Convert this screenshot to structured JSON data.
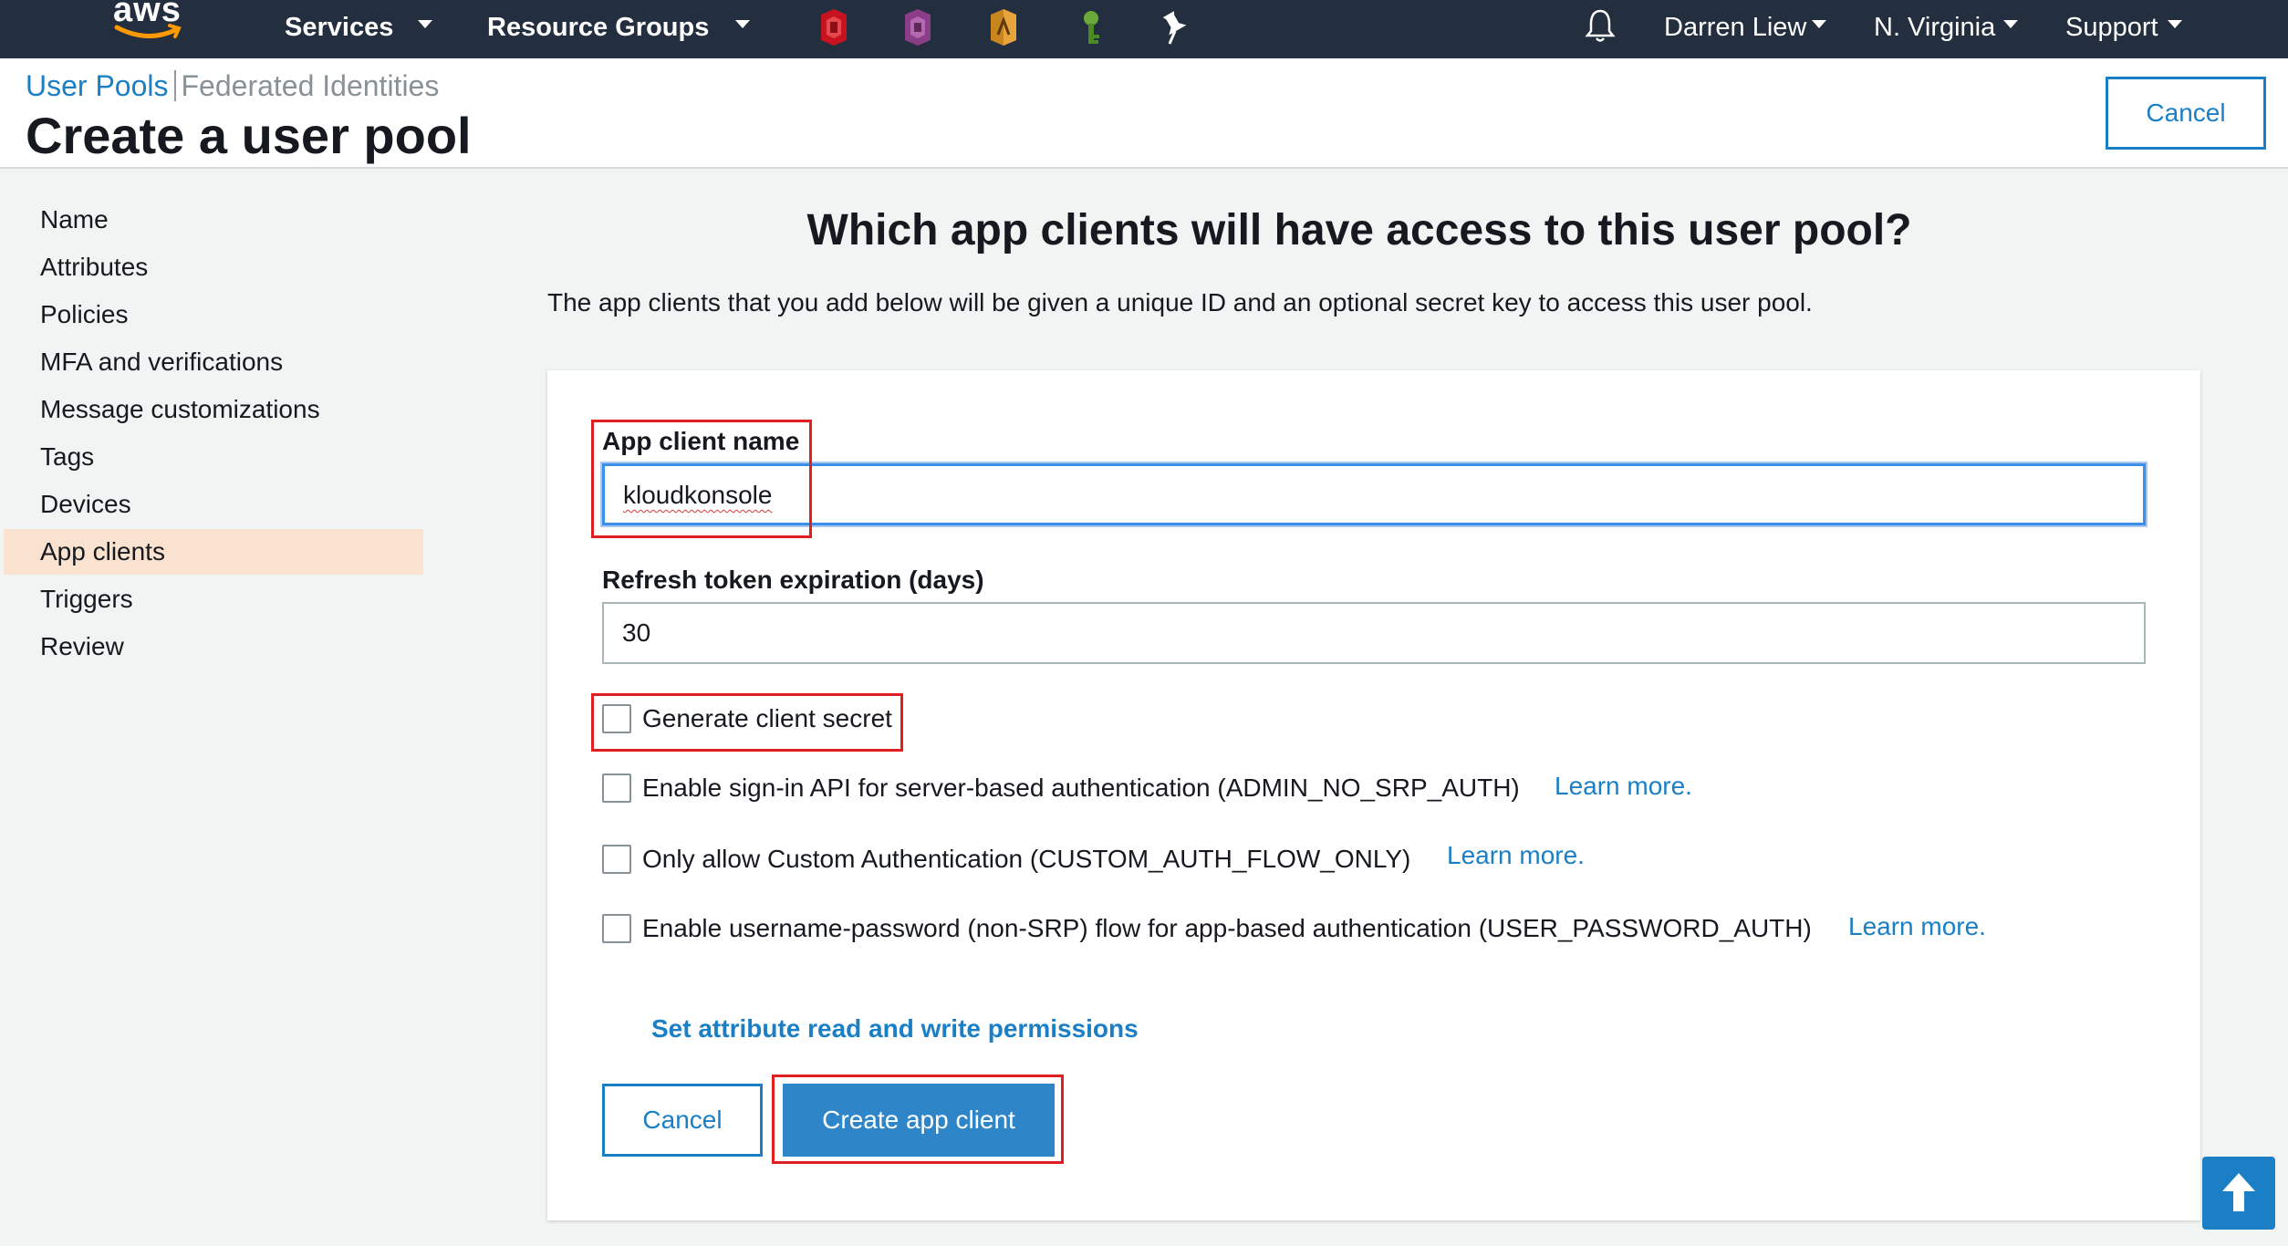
{
  "nav": {
    "logo": "aws",
    "services": "Services",
    "resource_groups": "Resource Groups",
    "pinned_icons": [
      "cloudtrail-icon",
      "cognito-icon",
      "lambda-icon",
      "iam-key-icon",
      "pin-icon"
    ],
    "user": "Darren Liew",
    "region": "N. Virginia",
    "support": "Support",
    "colors": {
      "bar": "#232f3e",
      "accent": "#ff9900"
    }
  },
  "header": {
    "crumb_user_pools": "User Pools",
    "crumb_federated": "Federated Identities",
    "title": "Create a user pool",
    "cancel": "Cancel"
  },
  "sidebar": {
    "items": [
      {
        "label": "Name"
      },
      {
        "label": "Attributes"
      },
      {
        "label": "Policies"
      },
      {
        "label": "MFA and verifications"
      },
      {
        "label": "Message customizations"
      },
      {
        "label": "Tags"
      },
      {
        "label": "Devices"
      },
      {
        "label": "App clients",
        "active": true
      },
      {
        "label": "Triggers"
      },
      {
        "label": "Review"
      }
    ]
  },
  "main": {
    "heading": "Which app clients will have access to this user pool?",
    "description": "The app clients that you add below will be given a unique ID and an optional secret key to access this user pool.",
    "form": {
      "client_name_label": "App client name",
      "client_name_value": "kloudkonsole",
      "refresh_label": "Refresh token expiration (days)",
      "refresh_value": "30",
      "options": [
        {
          "label": "Generate client secret",
          "checked": false
        },
        {
          "label": "Enable sign-in API for server-based authentication (ADMIN_NO_SRP_AUTH)",
          "checked": false,
          "link": "Learn more."
        },
        {
          "label": "Only allow Custom Authentication (CUSTOM_AUTH_FLOW_ONLY)",
          "checked": false,
          "link": "Learn more."
        },
        {
          "label": "Enable username-password (non-SRP) flow for app-based authentication (USER_PASSWORD_AUTH)",
          "checked": false,
          "link": "Learn more."
        }
      ],
      "permissions_link": "Set attribute read and write permissions",
      "cancel": "Cancel",
      "create": "Create app client"
    }
  },
  "colors": {
    "link": "#1b7fc6",
    "primary_button": "#2e86c9",
    "highlight": "#e02020",
    "active_nav": "#f9e2cf"
  }
}
